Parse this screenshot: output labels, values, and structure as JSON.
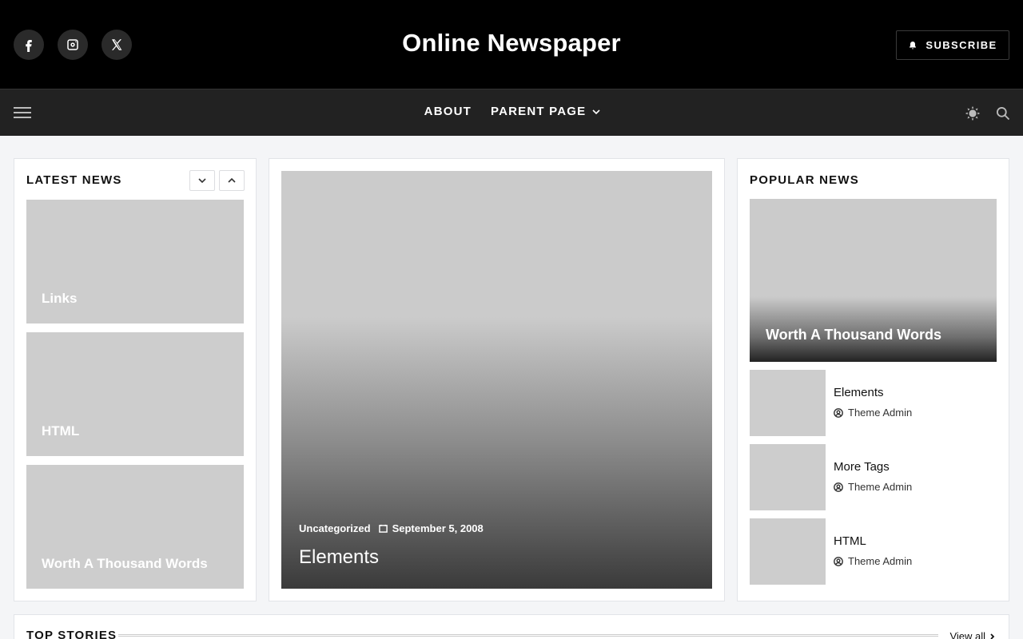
{
  "header": {
    "site_title": "Online Newspaper",
    "subscribe_label": "SUBSCRIBE",
    "social": [
      "facebook-icon",
      "instagram-icon",
      "x-icon"
    ]
  },
  "nav": {
    "items": [
      {
        "label": "ABOUT"
      },
      {
        "label": "PARENT PAGE",
        "has_dropdown": true
      }
    ]
  },
  "latest_news": {
    "title": "LATEST NEWS",
    "items": [
      {
        "label": "Links"
      },
      {
        "label": "HTML"
      },
      {
        "label": "Worth A Thousand Words"
      }
    ]
  },
  "featured": {
    "category": "Uncategorized",
    "date": "September 5, 2008",
    "title": "Elements"
  },
  "popular_news": {
    "title": "POPULAR NEWS",
    "hero": {
      "label": "Worth A Thousand Words"
    },
    "items": [
      {
        "title": "Elements",
        "author": "Theme Admin"
      },
      {
        "title": "More Tags",
        "author": "Theme Admin"
      },
      {
        "title": "HTML",
        "author": "Theme Admin"
      }
    ]
  },
  "top_stories": {
    "title": "TOP STORIES",
    "view_all": "View all"
  },
  "colors": {
    "header_bg": "#000000",
    "nav_bg": "#222222",
    "page_bg": "#f4f5f7",
    "placeholder": "#cdcdcd"
  }
}
